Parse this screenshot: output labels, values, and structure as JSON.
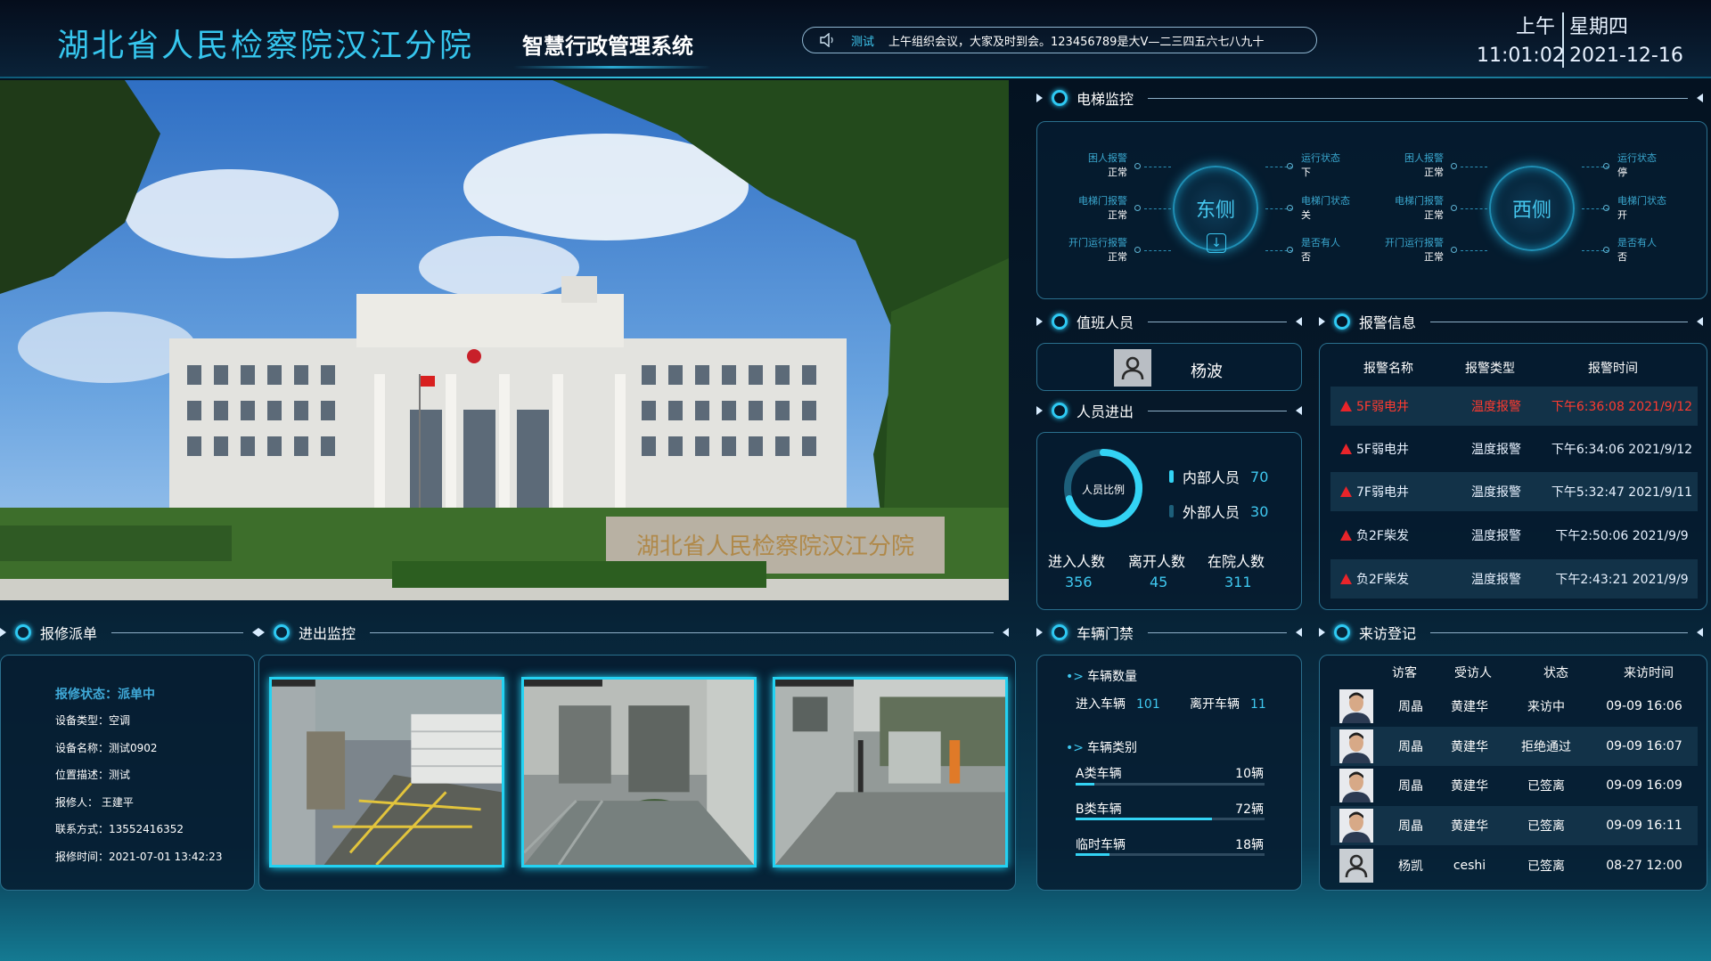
{
  "header": {
    "site_title": "湖北省人民检察院汉江分院",
    "system_title": "智慧行政管理系统",
    "notice_tag": "测试",
    "notice_text": "上午组织会议，大家及时到会。123456789是大V—二三四五六七八九十",
    "ampm": "上午",
    "weekday": "星期四",
    "time": "11:01:02",
    "date": "2021-12-16"
  },
  "photo": {
    "sign_text": "湖北省人民检察院汉江分院"
  },
  "elevator": {
    "title": "电梯监控",
    "east": {
      "name": "东侧",
      "left": [
        {
          "label": "困人报警",
          "value": "正常"
        },
        {
          "label": "电梯门报警",
          "value": "正常"
        },
        {
          "label": "开门运行报警",
          "value": "正常"
        }
      ],
      "right": [
        {
          "label": "运行状态",
          "value": "下"
        },
        {
          "label": "电梯门状态",
          "value": "关"
        },
        {
          "label": "是否有人",
          "value": "否"
        }
      ],
      "arrow": "↓"
    },
    "west": {
      "name": "西侧",
      "left": [
        {
          "label": "困人报警",
          "value": "正常"
        },
        {
          "label": "电梯门报警",
          "value": "正常"
        },
        {
          "label": "开门运行报警",
          "value": "正常"
        }
      ],
      "right": [
        {
          "label": "运行状态",
          "value": "停"
        },
        {
          "label": "电梯门状态",
          "value": "开"
        },
        {
          "label": "是否有人",
          "value": "否"
        }
      ]
    }
  },
  "duty": {
    "title": "值班人员",
    "name": "杨波"
  },
  "people": {
    "title": "人员进出",
    "donut_label": "人员比例",
    "internal_label": "内部人员",
    "internal_count": "70",
    "external_label": "外部人员",
    "external_count": "30",
    "internal_fraction": 0.7,
    "colors": {
      "internal": "#33d3f4",
      "external": "#1d5f7a"
    },
    "stats": [
      {
        "label": "进入人数",
        "value": "356"
      },
      {
        "label": "离开人数",
        "value": "45"
      },
      {
        "label": "在院人数",
        "value": "311"
      }
    ]
  },
  "alarm": {
    "title": "报警信息",
    "headers": [
      "报警名称",
      "报警类型",
      "报警时间"
    ],
    "rows": [
      {
        "name": "5F弱电井",
        "type": "温度报警",
        "time": "下午6:36:08 2021/9/12",
        "highlight": true
      },
      {
        "name": "5F弱电井",
        "type": "温度报警",
        "time": "下午6:34:06 2021/9/12",
        "highlight": false
      },
      {
        "name": "7F弱电井",
        "type": "温度报警",
        "time": "下午5:32:47 2021/9/11",
        "highlight": false
      },
      {
        "name": "负2F柴发",
        "type": "温度报警",
        "time": "下午2:50:06 2021/9/9",
        "highlight": false
      },
      {
        "name": "负2F柴发",
        "type": "温度报警",
        "time": "下午2:43:21 2021/9/9",
        "highlight": false
      }
    ],
    "colors": {
      "warn": "#e8242a",
      "highlight_text": "#ff3b30"
    }
  },
  "repair": {
    "title": "报修派单",
    "status": "报修状态：派单中",
    "lines": [
      "设备类型：空调",
      "设备名称：测试0902",
      "位置描述：测试",
      "报修人：  王建平",
      "联系方式：13552416352",
      "报修时间：2021-07-01 13:42:23"
    ]
  },
  "access": {
    "title": "进出监控",
    "cams": [
      {
        "name": "camera-1",
        "caption": ""
      },
      {
        "name": "camera-2",
        "caption": ""
      },
      {
        "name": "camera-3",
        "caption": ""
      }
    ]
  },
  "vehicles": {
    "title": "车辆门禁",
    "count_title": "车辆数量",
    "enter_label": "进入车辆",
    "enter_count": "101",
    "leave_label": "离开车辆",
    "leave_count": "11",
    "type_title": "车辆类别",
    "types": [
      {
        "label": "A类车辆",
        "count": "10辆",
        "fraction": 0.1
      },
      {
        "label": "B类车辆",
        "count": "72辆",
        "fraction": 0.72
      },
      {
        "label": "临时车辆",
        "count": "18辆",
        "fraction": 0.18
      }
    ]
  },
  "visitors": {
    "title": "来访登记",
    "headers": [
      "访客",
      "受访人",
      "状态",
      "来访时间"
    ],
    "rows": [
      {
        "visitor": "周晶",
        "host": "黄建华",
        "status": "来访中",
        "time": "09-09 16:06",
        "photo": "face"
      },
      {
        "visitor": "周晶",
        "host": "黄建华",
        "status": "拒绝通过",
        "time": "09-09 16:07",
        "photo": "face"
      },
      {
        "visitor": "周晶",
        "host": "黄建华",
        "status": "已签离",
        "time": "09-09 16:09",
        "photo": "face"
      },
      {
        "visitor": "周晶",
        "host": "黄建华",
        "status": "已签离",
        "time": "09-09 16:11",
        "photo": "face"
      },
      {
        "visitor": "杨凯",
        "host": "ceshi",
        "status": "已签离",
        "time": "08-27 12:00",
        "photo": "placeholder"
      }
    ]
  }
}
